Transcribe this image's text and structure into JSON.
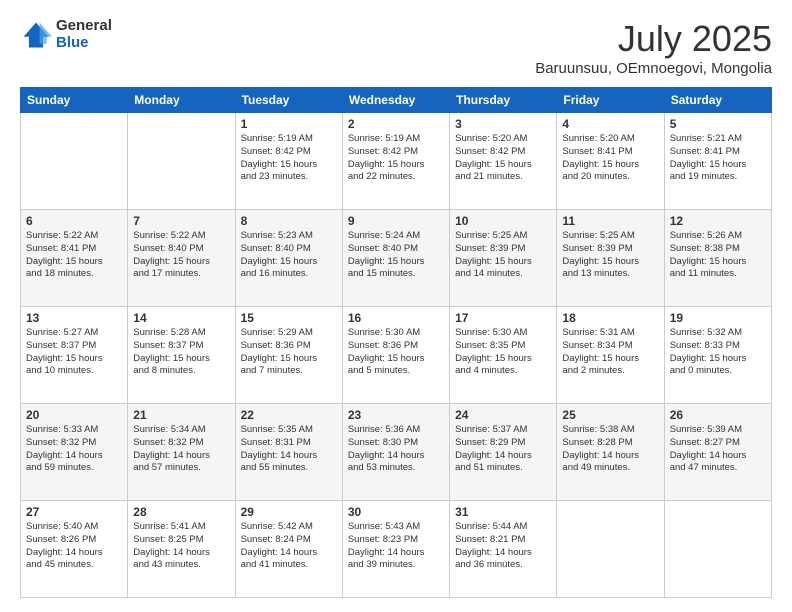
{
  "logo": {
    "general": "General",
    "blue": "Blue"
  },
  "title": "July 2025",
  "subtitle": "Baruunsuu, OEmnoegovi, Mongolia",
  "days_of_week": [
    "Sunday",
    "Monday",
    "Tuesday",
    "Wednesday",
    "Thursday",
    "Friday",
    "Saturday"
  ],
  "weeks": [
    [
      {
        "day": "",
        "info": ""
      },
      {
        "day": "",
        "info": ""
      },
      {
        "day": "1",
        "info": "Sunrise: 5:19 AM\nSunset: 8:42 PM\nDaylight: 15 hours\nand 23 minutes."
      },
      {
        "day": "2",
        "info": "Sunrise: 5:19 AM\nSunset: 8:42 PM\nDaylight: 15 hours\nand 22 minutes."
      },
      {
        "day": "3",
        "info": "Sunrise: 5:20 AM\nSunset: 8:42 PM\nDaylight: 15 hours\nand 21 minutes."
      },
      {
        "day": "4",
        "info": "Sunrise: 5:20 AM\nSunset: 8:41 PM\nDaylight: 15 hours\nand 20 minutes."
      },
      {
        "day": "5",
        "info": "Sunrise: 5:21 AM\nSunset: 8:41 PM\nDaylight: 15 hours\nand 19 minutes."
      }
    ],
    [
      {
        "day": "6",
        "info": "Sunrise: 5:22 AM\nSunset: 8:41 PM\nDaylight: 15 hours\nand 18 minutes."
      },
      {
        "day": "7",
        "info": "Sunrise: 5:22 AM\nSunset: 8:40 PM\nDaylight: 15 hours\nand 17 minutes."
      },
      {
        "day": "8",
        "info": "Sunrise: 5:23 AM\nSunset: 8:40 PM\nDaylight: 15 hours\nand 16 minutes."
      },
      {
        "day": "9",
        "info": "Sunrise: 5:24 AM\nSunset: 8:40 PM\nDaylight: 15 hours\nand 15 minutes."
      },
      {
        "day": "10",
        "info": "Sunrise: 5:25 AM\nSunset: 8:39 PM\nDaylight: 15 hours\nand 14 minutes."
      },
      {
        "day": "11",
        "info": "Sunrise: 5:25 AM\nSunset: 8:39 PM\nDaylight: 15 hours\nand 13 minutes."
      },
      {
        "day": "12",
        "info": "Sunrise: 5:26 AM\nSunset: 8:38 PM\nDaylight: 15 hours\nand 11 minutes."
      }
    ],
    [
      {
        "day": "13",
        "info": "Sunrise: 5:27 AM\nSunset: 8:37 PM\nDaylight: 15 hours\nand 10 minutes."
      },
      {
        "day": "14",
        "info": "Sunrise: 5:28 AM\nSunset: 8:37 PM\nDaylight: 15 hours\nand 8 minutes."
      },
      {
        "day": "15",
        "info": "Sunrise: 5:29 AM\nSunset: 8:36 PM\nDaylight: 15 hours\nand 7 minutes."
      },
      {
        "day": "16",
        "info": "Sunrise: 5:30 AM\nSunset: 8:36 PM\nDaylight: 15 hours\nand 5 minutes."
      },
      {
        "day": "17",
        "info": "Sunrise: 5:30 AM\nSunset: 8:35 PM\nDaylight: 15 hours\nand 4 minutes."
      },
      {
        "day": "18",
        "info": "Sunrise: 5:31 AM\nSunset: 8:34 PM\nDaylight: 15 hours\nand 2 minutes."
      },
      {
        "day": "19",
        "info": "Sunrise: 5:32 AM\nSunset: 8:33 PM\nDaylight: 15 hours\nand 0 minutes."
      }
    ],
    [
      {
        "day": "20",
        "info": "Sunrise: 5:33 AM\nSunset: 8:32 PM\nDaylight: 14 hours\nand 59 minutes."
      },
      {
        "day": "21",
        "info": "Sunrise: 5:34 AM\nSunset: 8:32 PM\nDaylight: 14 hours\nand 57 minutes."
      },
      {
        "day": "22",
        "info": "Sunrise: 5:35 AM\nSunset: 8:31 PM\nDaylight: 14 hours\nand 55 minutes."
      },
      {
        "day": "23",
        "info": "Sunrise: 5:36 AM\nSunset: 8:30 PM\nDaylight: 14 hours\nand 53 minutes."
      },
      {
        "day": "24",
        "info": "Sunrise: 5:37 AM\nSunset: 8:29 PM\nDaylight: 14 hours\nand 51 minutes."
      },
      {
        "day": "25",
        "info": "Sunrise: 5:38 AM\nSunset: 8:28 PM\nDaylight: 14 hours\nand 49 minutes."
      },
      {
        "day": "26",
        "info": "Sunrise: 5:39 AM\nSunset: 8:27 PM\nDaylight: 14 hours\nand 47 minutes."
      }
    ],
    [
      {
        "day": "27",
        "info": "Sunrise: 5:40 AM\nSunset: 8:26 PM\nDaylight: 14 hours\nand 45 minutes."
      },
      {
        "day": "28",
        "info": "Sunrise: 5:41 AM\nSunset: 8:25 PM\nDaylight: 14 hours\nand 43 minutes."
      },
      {
        "day": "29",
        "info": "Sunrise: 5:42 AM\nSunset: 8:24 PM\nDaylight: 14 hours\nand 41 minutes."
      },
      {
        "day": "30",
        "info": "Sunrise: 5:43 AM\nSunset: 8:23 PM\nDaylight: 14 hours\nand 39 minutes."
      },
      {
        "day": "31",
        "info": "Sunrise: 5:44 AM\nSunset: 8:21 PM\nDaylight: 14 hours\nand 36 minutes."
      },
      {
        "day": "",
        "info": ""
      },
      {
        "day": "",
        "info": ""
      }
    ]
  ]
}
